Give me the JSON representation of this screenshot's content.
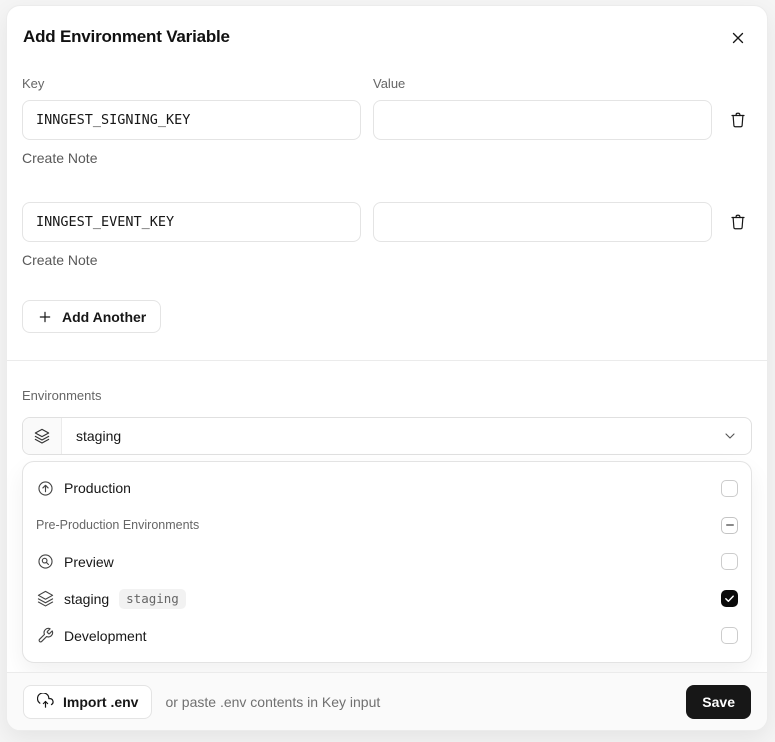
{
  "modal": {
    "title": "Add Environment Variable"
  },
  "form": {
    "key_label": "Key",
    "value_label": "Value",
    "rows": [
      {
        "key": "INNGEST_SIGNING_KEY",
        "value": "",
        "note_label": "Create Note"
      },
      {
        "key": "INNGEST_EVENT_KEY",
        "value": "",
        "note_label": "Create Note"
      }
    ],
    "add_another_label": "Add Another"
  },
  "environments": {
    "label": "Environments",
    "selected_value": "staging",
    "options": [
      {
        "label": "Production",
        "icon": "arrow-up-circle-icon",
        "state": "unchecked"
      },
      {
        "label": "Pre-Production Environments",
        "type": "group-header",
        "state": "indeterminate"
      },
      {
        "label": "Preview",
        "icon": "magnifier-circle-icon",
        "state": "unchecked"
      },
      {
        "label": "staging",
        "icon": "layers-icon",
        "badge": "staging",
        "state": "checked"
      },
      {
        "label": "Development",
        "icon": "wrench-icon",
        "state": "unchecked"
      }
    ]
  },
  "footer": {
    "import_label": "Import .env",
    "hint": "or paste .env contents in Key input",
    "save_label": "Save"
  },
  "colors": {
    "save_button_bg": "#171717",
    "checkbox_checked_bg": "#0a0a0a",
    "badge_bg": "#f2f2f2",
    "footer_bg": "#fafafa"
  }
}
